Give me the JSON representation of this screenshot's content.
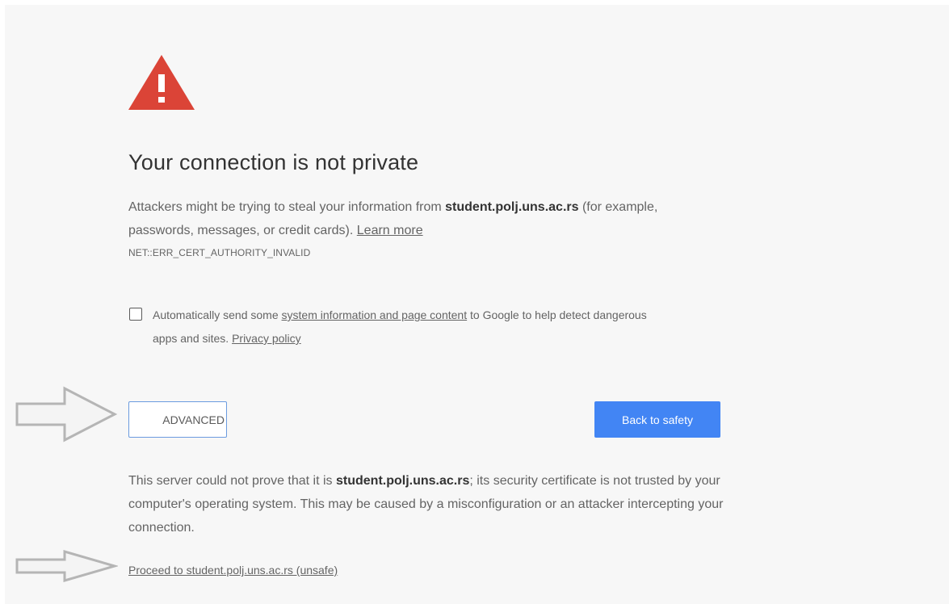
{
  "icons": {
    "warning": "warning-triangle-icon",
    "arrow": "arrow-right-outline-icon"
  },
  "colors": {
    "warning": "#db4437",
    "primary_button": "#4285f4",
    "background": "#f7f7f7",
    "text": "#646464"
  },
  "interstitial": {
    "title": "Your connection is not private",
    "main_before": "Attackers might be trying to steal your information from ",
    "host": "student.polj.uns.ac.rs",
    "main_after": " (for example, passwords, messages, or credit cards). ",
    "learn_more": "Learn more",
    "error_code": "NET::ERR_CERT_AUTHORITY_INVALID",
    "optin_before": "Automatically send some ",
    "optin_link": "system information and page content",
    "optin_after": " to Google to help detect dangerous apps and sites. ",
    "privacy_policy": "Privacy policy",
    "advanced_label": "ADVANCED",
    "back_label": "Back to safety",
    "details_before": "This server could not prove that it is ",
    "details_host": "student.polj.uns.ac.rs",
    "details_after": "; its security certificate is not trusted by your computer's operating system. This may be caused by a misconfiguration or an attacker intercepting your connection.",
    "proceed_link": "Proceed to student.polj.uns.ac.rs (unsafe)"
  }
}
